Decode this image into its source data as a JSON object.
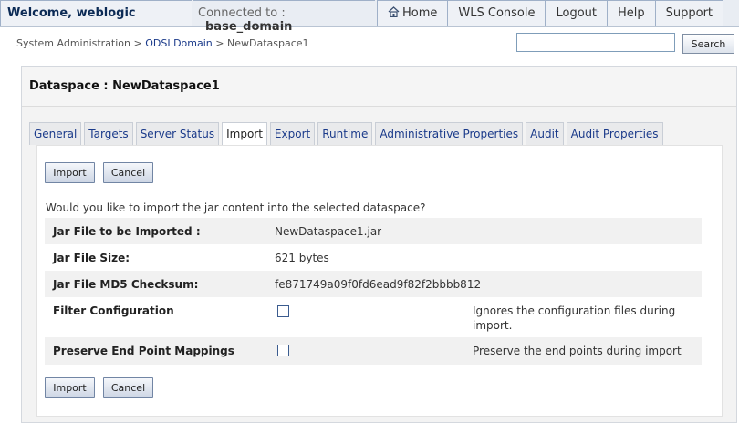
{
  "header": {
    "welcome": "Welcome, weblogic",
    "connected_label": "Connected to :",
    "domain": "base_domain",
    "links": [
      "Home",
      "WLS Console",
      "Logout",
      "Help",
      "Support"
    ]
  },
  "breadcrumb": {
    "root": "System Administration",
    "sep1": ">",
    "domain_link": "ODSI Domain",
    "sep2": ">",
    "current": "NewDataspace1"
  },
  "search": {
    "placeholder": "",
    "button_label": "Search"
  },
  "panel": {
    "title": "Dataspace : NewDataspace1"
  },
  "tabs": [
    "General",
    "Targets",
    "Server Status",
    "Import",
    "Export",
    "Runtime",
    "Administrative Properties",
    "Audit",
    "Audit Properties"
  ],
  "active_tab": "Import",
  "form": {
    "import_label": "Import",
    "cancel_label": "Cancel",
    "question": "Would you like to import the jar content into the selected dataspace?",
    "jar_file_label": "Jar File to be Imported :",
    "jar_file_value": "NewDataspace1.jar",
    "jar_size_label": "Jar File Size:",
    "jar_size_value": "621 bytes",
    "md5_label": "Jar File MD5 Checksum:",
    "md5_value": "fe871749a09f0fd6ead9f82f2bbbb812",
    "filter_label": "Filter Configuration",
    "filter_checked": false,
    "filter_desc": "Ignores the configuration files during import.",
    "preserve_label": "Preserve End Point Mappings",
    "preserve_checked": false,
    "preserve_desc": "Preserve the end points during import"
  }
}
